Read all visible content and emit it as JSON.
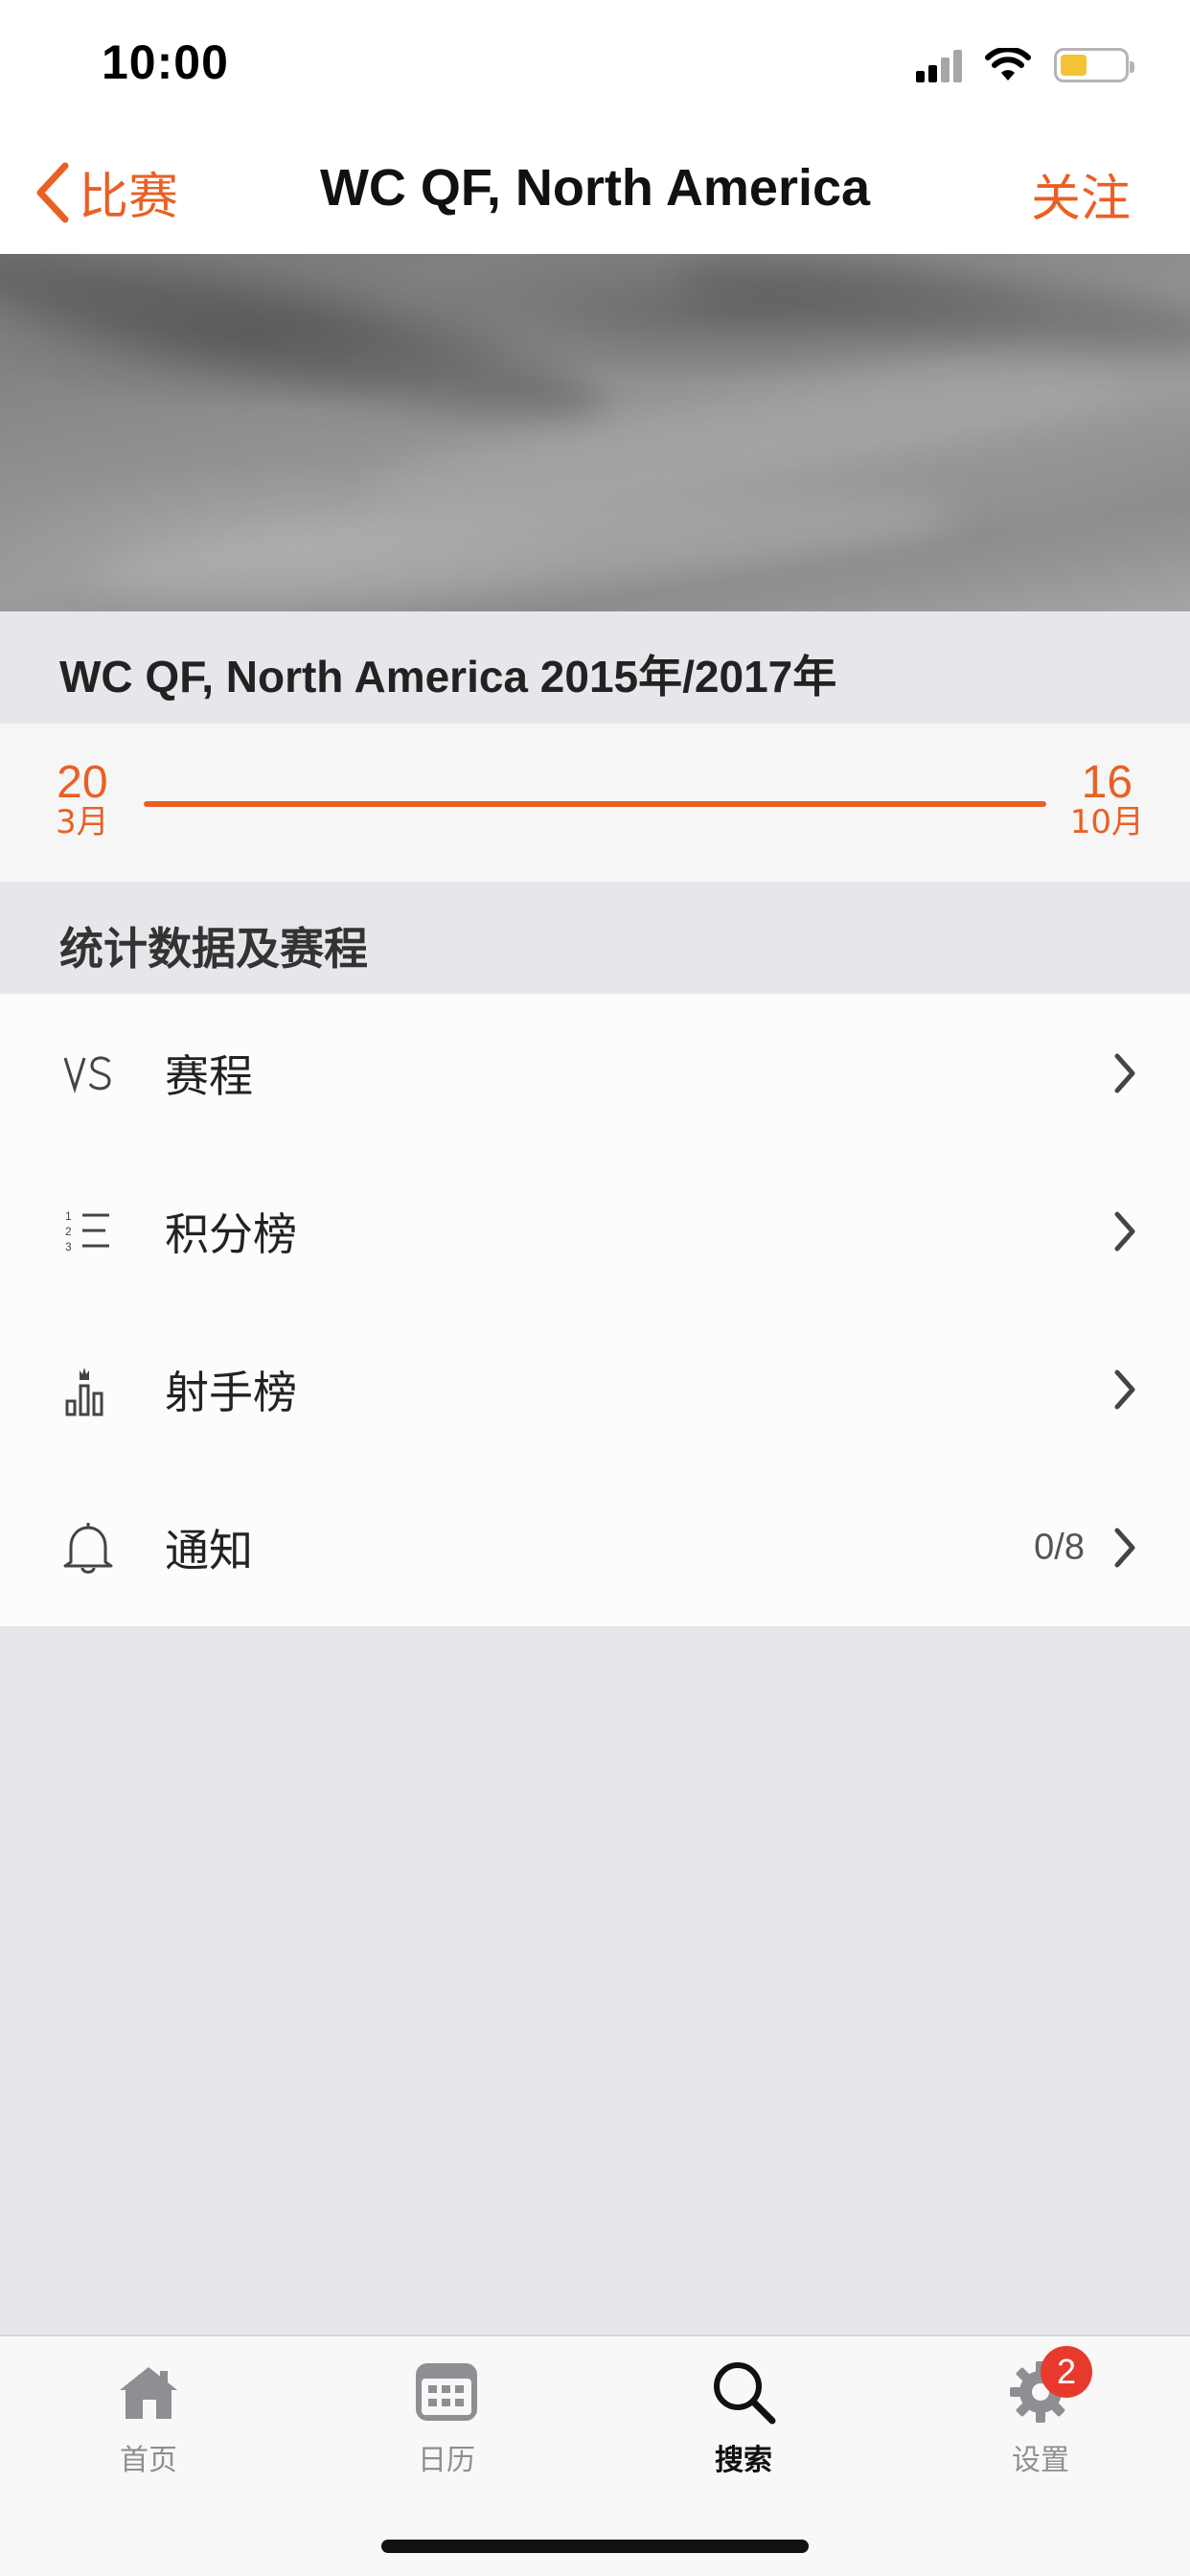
{
  "status_bar": {
    "time": "10:00"
  },
  "navbar": {
    "back_label": "比赛",
    "title": "WC QF, North America",
    "follow_label": "关注"
  },
  "competition": {
    "title": "WC QF, North America 2015年/2017年"
  },
  "timeline": {
    "start": {
      "day": "20",
      "month": "3月"
    },
    "end": {
      "day": "16",
      "month": "10月"
    },
    "color": "#ea5f24"
  },
  "section": {
    "title": "统计数据及赛程"
  },
  "menu": [
    {
      "icon": "vs-icon",
      "label": "赛程",
      "value": ""
    },
    {
      "icon": "ranked-list-icon",
      "label": "积分榜",
      "value": ""
    },
    {
      "icon": "bar-chart-crown-icon",
      "label": "射手榜",
      "value": ""
    },
    {
      "icon": "bell-icon",
      "label": "通知",
      "value": "0/8"
    }
  ],
  "tabbar": {
    "tabs": [
      {
        "label": "首页",
        "icon": "home-icon",
        "active": false
      },
      {
        "label": "日历",
        "icon": "calendar-icon",
        "active": false
      },
      {
        "label": "搜索",
        "icon": "search-icon",
        "active": true
      },
      {
        "label": "设置",
        "icon": "gear-icon",
        "active": false,
        "badge": "2"
      }
    ]
  },
  "colors": {
    "accent": "#ea5f24",
    "badge": "#e83a2c",
    "background": "#e6e7eb"
  }
}
